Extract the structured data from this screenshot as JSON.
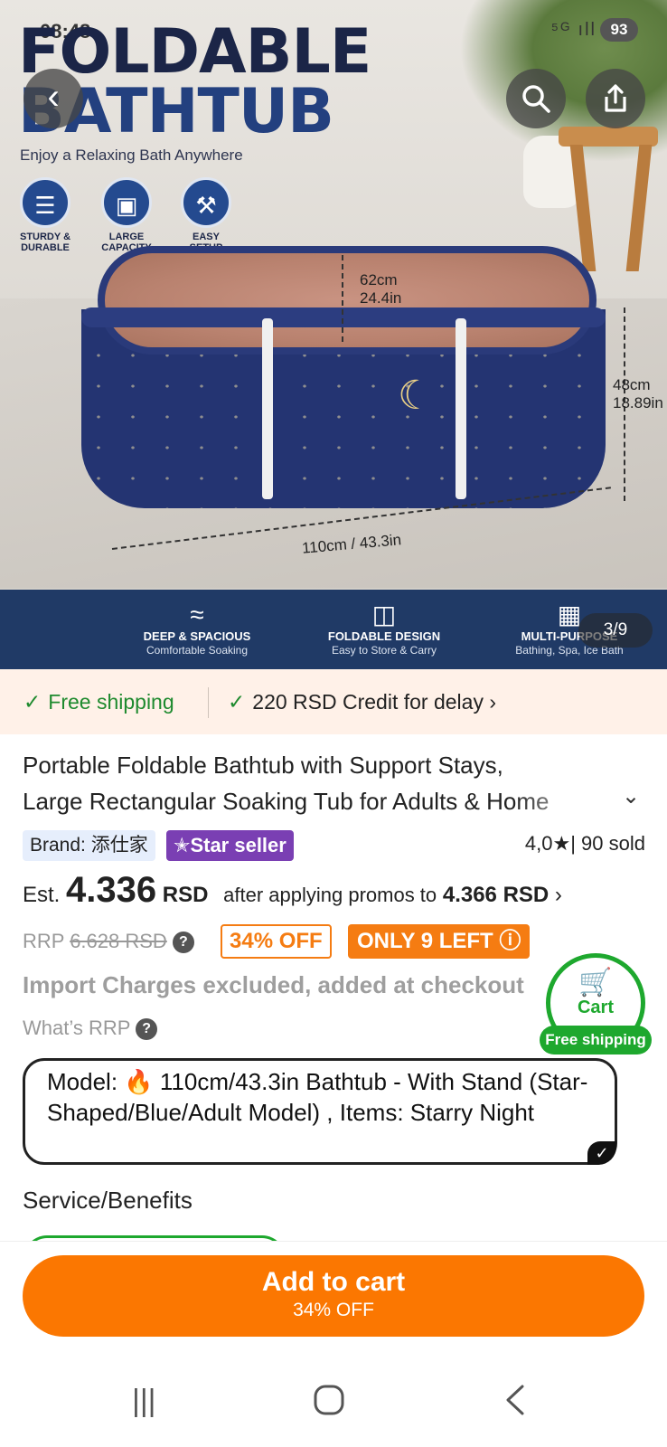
{
  "status_bar": {
    "time": "08:48",
    "signal": "⁵ᴳ ıll",
    "battery": "93"
  },
  "hero": {
    "title_line1": "FOLDABLE",
    "title_line2": "BATHTUB",
    "subtitle": "Enjoy a Relaxing Bath Anywhere",
    "features": [
      {
        "label_line1": "STURDY &",
        "label_line2": "DURABLE",
        "icon": "layers-icon"
      },
      {
        "label_line1": "LARGE",
        "label_line2": "CAPACITY",
        "icon": "box-icon"
      },
      {
        "label_line1": "EASY",
        "label_line2": "SETUP",
        "icon": "tools-icon"
      }
    ],
    "dimensions": {
      "depth_cm": "62cm",
      "depth_in": "24.4in",
      "height_cm": "48cm",
      "height_in": "18.89in",
      "length": "110cm / 43.3in"
    },
    "band_features": [
      {
        "title": "DEEP & SPACIOUS",
        "subtitle": "Comfortable Soaking",
        "icon": "water-icon"
      },
      {
        "title": "FOLDABLE DESIGN",
        "subtitle": "Easy to Store & Carry",
        "icon": "map-fold-icon"
      },
      {
        "title": "MULTI-PURPOSE",
        "subtitle": "Bathing, Spa, Ice Bath",
        "icon": "grid-icon"
      }
    ],
    "image_counter": "3/9"
  },
  "shipping": {
    "free": "Free shipping",
    "credit": "220 RSD Credit for delay",
    "credit_chevron": "›"
  },
  "product": {
    "title_line1": "Portable Foldable Bathtub with Support Stays,",
    "title_line2": "Large Rectangular Soaking Tub for Adults & Home",
    "brand_label": "Brand:",
    "brand_name": "添仕家",
    "star_seller": "Star seller",
    "rating": "4,0",
    "sold": "| 90 sold",
    "est_label": "Est.",
    "price": "4.336",
    "currency": "RSD",
    "after_promos": "after applying promos to",
    "promo_price": "4.366 RSD",
    "rrp_label": "RRP",
    "rrp_value": "6.628 RSD",
    "discount_badge": "34% OFF",
    "stock_badge": "ONLY 9 LEFT",
    "import_note": "Import Charges excluded, added at checkout",
    "whats_rrp": "What’s RRP",
    "model_label": "Model:",
    "model_text": "110cm/43.3in Bathtub - With Stand (Star-Shaped/Blue/Adult Model) , Items: Starry Night",
    "service_heading": "Service/Benefits"
  },
  "cart_float": {
    "label": "Cart",
    "badge": "Free shipping"
  },
  "add_to_cart": {
    "label": "Add to cart",
    "sub": "34% OFF"
  },
  "colors": {
    "accent": "#fb7701",
    "green": "#1ea82e",
    "star_seller": "#7a3fb3",
    "band": "#203a66"
  }
}
